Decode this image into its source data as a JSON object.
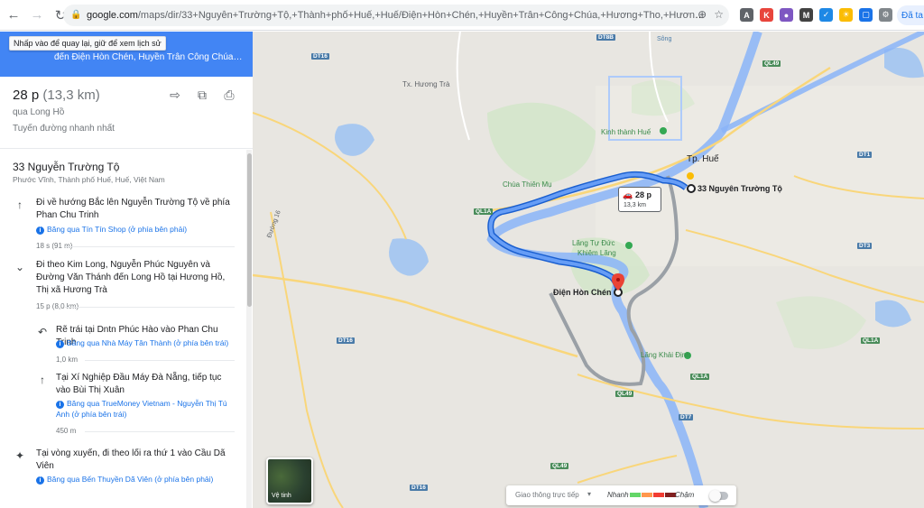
{
  "browser": {
    "url_host": "google.com",
    "url_path": "/maps/dir/33+Nguyễn+Trường+Tộ,+Thành+phố+Huế,+Huế/Điện+Hòn+Chén,+Huyền+Trân+Công+Chúa,+Hương+Tho,+Hương+Trà,+Thừa+Th...",
    "profile_label": "Đã ta"
  },
  "panel": {
    "tooltip": "Nhấp vào để quay lại, giữ để xem lịch sử",
    "header_line1": "Vĩnh, Thành phố Huế,...",
    "header_line2": "đến Điện Hòn Chén, Huyền Trân Công Chúa, Hương T...",
    "duration": "28 p",
    "distance": "(13,3 km)",
    "via": "qua Long Hồ",
    "fastest": "Tuyến đường nhanh nhất",
    "origin": "33 Nguyễn Trường Tộ",
    "origin_sub": "Phước Vĩnh, Thành phố Huế, Huế, Việt Nam",
    "steps": [
      {
        "text": "Đi về hướng Bắc lên Nguyễn Trường Tộ về phía Phan Chu Trinh",
        "note": "Băng qua Tín Tín Shop (ở phía bên phải)",
        "dist": "18 s (91 m)"
      },
      {
        "text": "Đi theo Kim Long, Nguyễn Phúc Nguyên và Đường Văn Thánh đến Long Hồ tại Hương Hồ, Thị xã Hương Trà",
        "dist": "15 p (8,0 km)"
      },
      {
        "text": "Rẽ trái tại Dntn Phúc Hào vào Phan Chu Trinh",
        "note": "Băng qua Nhà Máy Tân Thành (ở phía bên trái)",
        "dist": "1,0 km"
      },
      {
        "text": "Tại Xí Nghiệp Đầu Máy Đà Nẵng, tiếp tục vào Bùi Thị Xuân",
        "note": "Băng qua TrueMoney Vietnam - Nguyễn Thị Tú Anh (ở phía bên trái)",
        "dist": "450 m"
      },
      {
        "text": "Tại vòng xuyến, đi theo lối ra thứ 1 vào Cầu Dã Viên",
        "note": "Băng qua Bến Thuyền Dã Viên (ở phía bên phải)"
      }
    ]
  },
  "map": {
    "places": {
      "huong_tra": "Tx. Hương Trà",
      "kinh_thanh": "Kinh thành Huế",
      "tp_hue": "Tp. Huế",
      "chua_thien_mu": "Chùa Thiên Mụ",
      "lang_tu_duc": "Lăng Tự Đức",
      "khiem_lang": "Khiêm Lăng",
      "lang_khai_dinh": "Lăng Khải Định",
      "dest": "Điện Hòn Chén",
      "origin": "33 Nguyên Trường Tộ",
      "song": "Sông"
    },
    "roads": [
      "DT16",
      "DT8B",
      "QL49",
      "DT1",
      "QL1A",
      "DT3",
      "DT16",
      "QL1A",
      "QL1A",
      "QL49",
      "DT7",
      "QL49",
      "DT16",
      "QL1A"
    ],
    "route_chip": {
      "time": "28 p",
      "distance": "13,3 km"
    },
    "satellite_label": "Vệ tinh",
    "traffic": {
      "live": "Giao thông trực tiếp",
      "fast": "Nhanh",
      "slow": "Chậm"
    },
    "road_name": "Đường 16"
  },
  "colors": {
    "route": "#4285f4",
    "alt_route": "#9e9e9e",
    "river": "#8ab4f8",
    "header": "#4285f4"
  }
}
